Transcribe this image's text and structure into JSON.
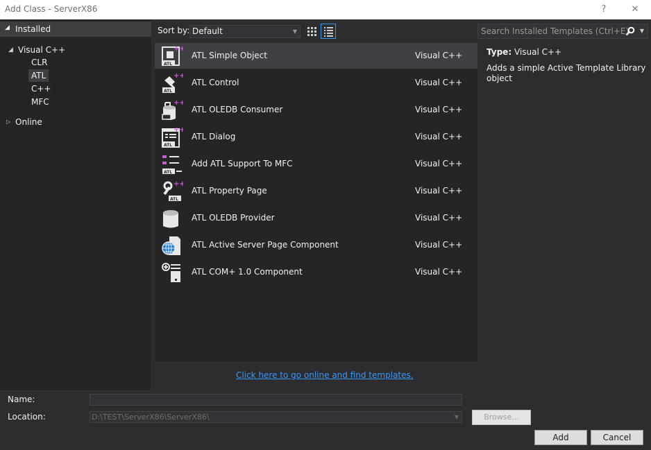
{
  "window": {
    "title": "Add Class - ServerX86",
    "help_label": "?",
    "close_label": "✕"
  },
  "tree": {
    "installed_label": "Installed",
    "items": [
      {
        "label": "Visual C++"
      },
      {
        "label": "CLR"
      },
      {
        "label": "ATL"
      },
      {
        "label": "C++"
      },
      {
        "label": "MFC"
      },
      {
        "label": "Online"
      }
    ]
  },
  "toolbar": {
    "sort_label": "Sort by:",
    "sort_value": "Default",
    "search_placeholder": "Search Installed Templates (Ctrl+E)"
  },
  "templates": [
    {
      "name": "ATL Simple Object",
      "lang": "Visual C++",
      "icon": "atl-simple-object-icon"
    },
    {
      "name": "ATL Control",
      "lang": "Visual C++",
      "icon": "atl-control-icon"
    },
    {
      "name": "ATL OLEDB Consumer",
      "lang": "Visual C++",
      "icon": "atl-oledb-consumer-icon"
    },
    {
      "name": "ATL Dialog",
      "lang": "Visual C++",
      "icon": "atl-dialog-icon"
    },
    {
      "name": "Add ATL Support To MFC",
      "lang": "Visual C++",
      "icon": "atl-mfc-support-icon"
    },
    {
      "name": "ATL Property Page",
      "lang": "Visual C++",
      "icon": "atl-property-page-icon"
    },
    {
      "name": "ATL OLEDB Provider",
      "lang": "Visual C++",
      "icon": "atl-oledb-provider-icon"
    },
    {
      "name": "ATL Active Server Page Component",
      "lang": "Visual C++",
      "icon": "atl-asp-component-icon"
    },
    {
      "name": "ATL COM+ 1.0 Component",
      "lang": "Visual C++",
      "icon": "atl-com-component-icon"
    }
  ],
  "info": {
    "type_label": "Type:",
    "type_value": "Visual C++",
    "description": "Adds a simple Active Template Library object"
  },
  "online_link": "Click here to go online and find templates.",
  "form": {
    "name_label": "Name:",
    "name_value": "",
    "location_label": "Location:",
    "location_value": "D:\\TEST\\ServerX86\\ServerX86\\",
    "browse_label": "Browse...",
    "add_label": "Add",
    "cancel_label": "Cancel"
  },
  "colors": {
    "background": "#2d2d30",
    "list_bg": "#252526",
    "selected": "#3f3f46",
    "accent": "#3399ff",
    "icon_plus": "#c75dd0"
  }
}
